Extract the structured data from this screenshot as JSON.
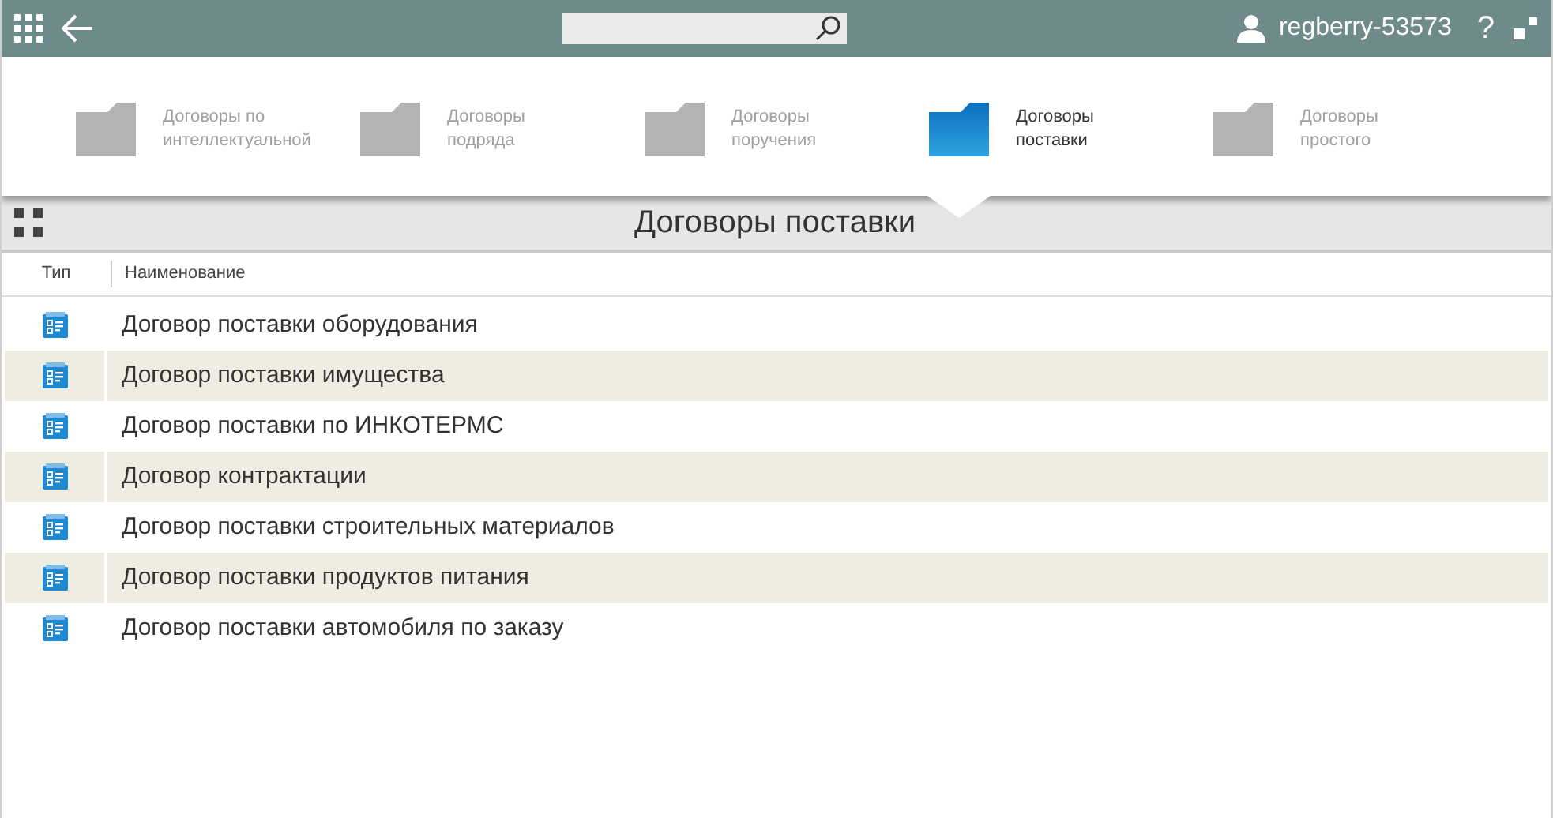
{
  "top_bar": {
    "username": "regberry-53573",
    "help": "?"
  },
  "categories": [
    {
      "label": "Договоры по интеллектуальной",
      "selected": false
    },
    {
      "label": "Договоры подряда",
      "selected": false
    },
    {
      "label": "Договоры поручения",
      "selected": false
    },
    {
      "label": "Договоры поставки",
      "selected": true
    },
    {
      "label": "Договоры простого",
      "selected": false
    }
  ],
  "page_title": "Договоры поставки",
  "table": {
    "columns": [
      "Тип",
      "Наименование"
    ],
    "rows": [
      {
        "name": "Договор поставки оборудования"
      },
      {
        "name": "Договор поставки имущества"
      },
      {
        "name": "Договор поставки по ИНКОТЕРМС"
      },
      {
        "name": "Договор контрактации"
      },
      {
        "name": "Договор поставки строительных материалов"
      },
      {
        "name": "Договор поставки продуктов питания"
      },
      {
        "name": "Договор поставки автомобиля по заказу"
      }
    ]
  }
}
